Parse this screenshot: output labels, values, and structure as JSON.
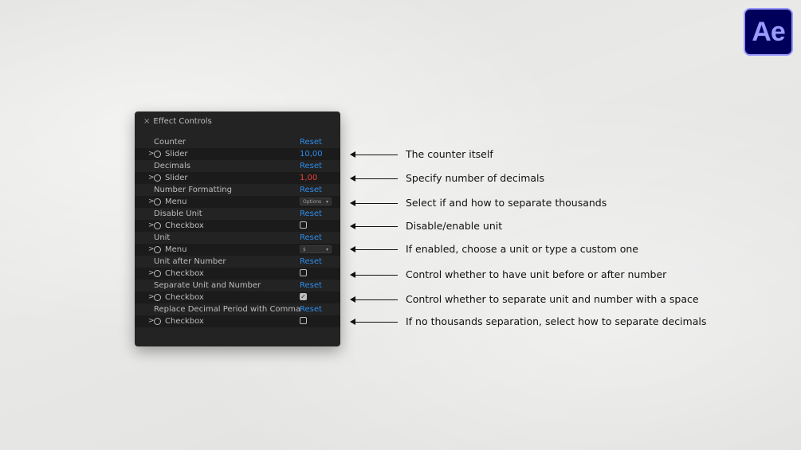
{
  "app": {
    "logo_text": "Ae",
    "logo_bg": "#00005b",
    "logo_fg": "#9999ff"
  },
  "panel": {
    "close_glyph": "×",
    "title": "Effect Controls",
    "rows": [
      {
        "label": "Counter",
        "reset": "Reset"
      },
      {
        "twirl": ">",
        "control": "Slider",
        "value": "10,00",
        "value_color": "blue"
      },
      {
        "label": "Decimals",
        "reset": "Reset"
      },
      {
        "twirl": ">",
        "control": "Slider",
        "value": "1,00",
        "value_color": "red"
      },
      {
        "label": "Number Formatting",
        "reset": "Reset"
      },
      {
        "twirl": ">",
        "control": "Menu",
        "menu_value": "Options"
      },
      {
        "label": "Disable Unit",
        "reset": "Reset"
      },
      {
        "twirl": ">",
        "control": "Checkbox",
        "checked": false
      },
      {
        "label": "Unit",
        "reset": "Reset"
      },
      {
        "twirl": ">",
        "control": "Menu",
        "menu_value": "$"
      },
      {
        "label": "Unit after Number",
        "reset": "Reset"
      },
      {
        "twirl": ">",
        "control": "Checkbox",
        "checked": false
      },
      {
        "label": "Separate Unit and Number",
        "reset": "Reset"
      },
      {
        "twirl": ">",
        "control": "Checkbox",
        "checked": true
      },
      {
        "label": "Replace Decimal Period with Comma",
        "reset": "Reset"
      },
      {
        "twirl": ">",
        "control": "Checkbox",
        "checked": false
      }
    ]
  },
  "annotations": [
    "The counter itself",
    "Specify number of decimals",
    "Select if and how to separate thousands",
    "Disable/enable unit",
    "If enabled, choose a unit or type a custom one",
    "Control whether to have unit before or after number",
    "Control whether to separate unit and number with a space",
    "If no thousands separation, select how to separate decimals"
  ],
  "colors": {
    "accent_blue": "#2d8ceb",
    "value_red": "#e8423b",
    "panel_bg": "#232323"
  }
}
